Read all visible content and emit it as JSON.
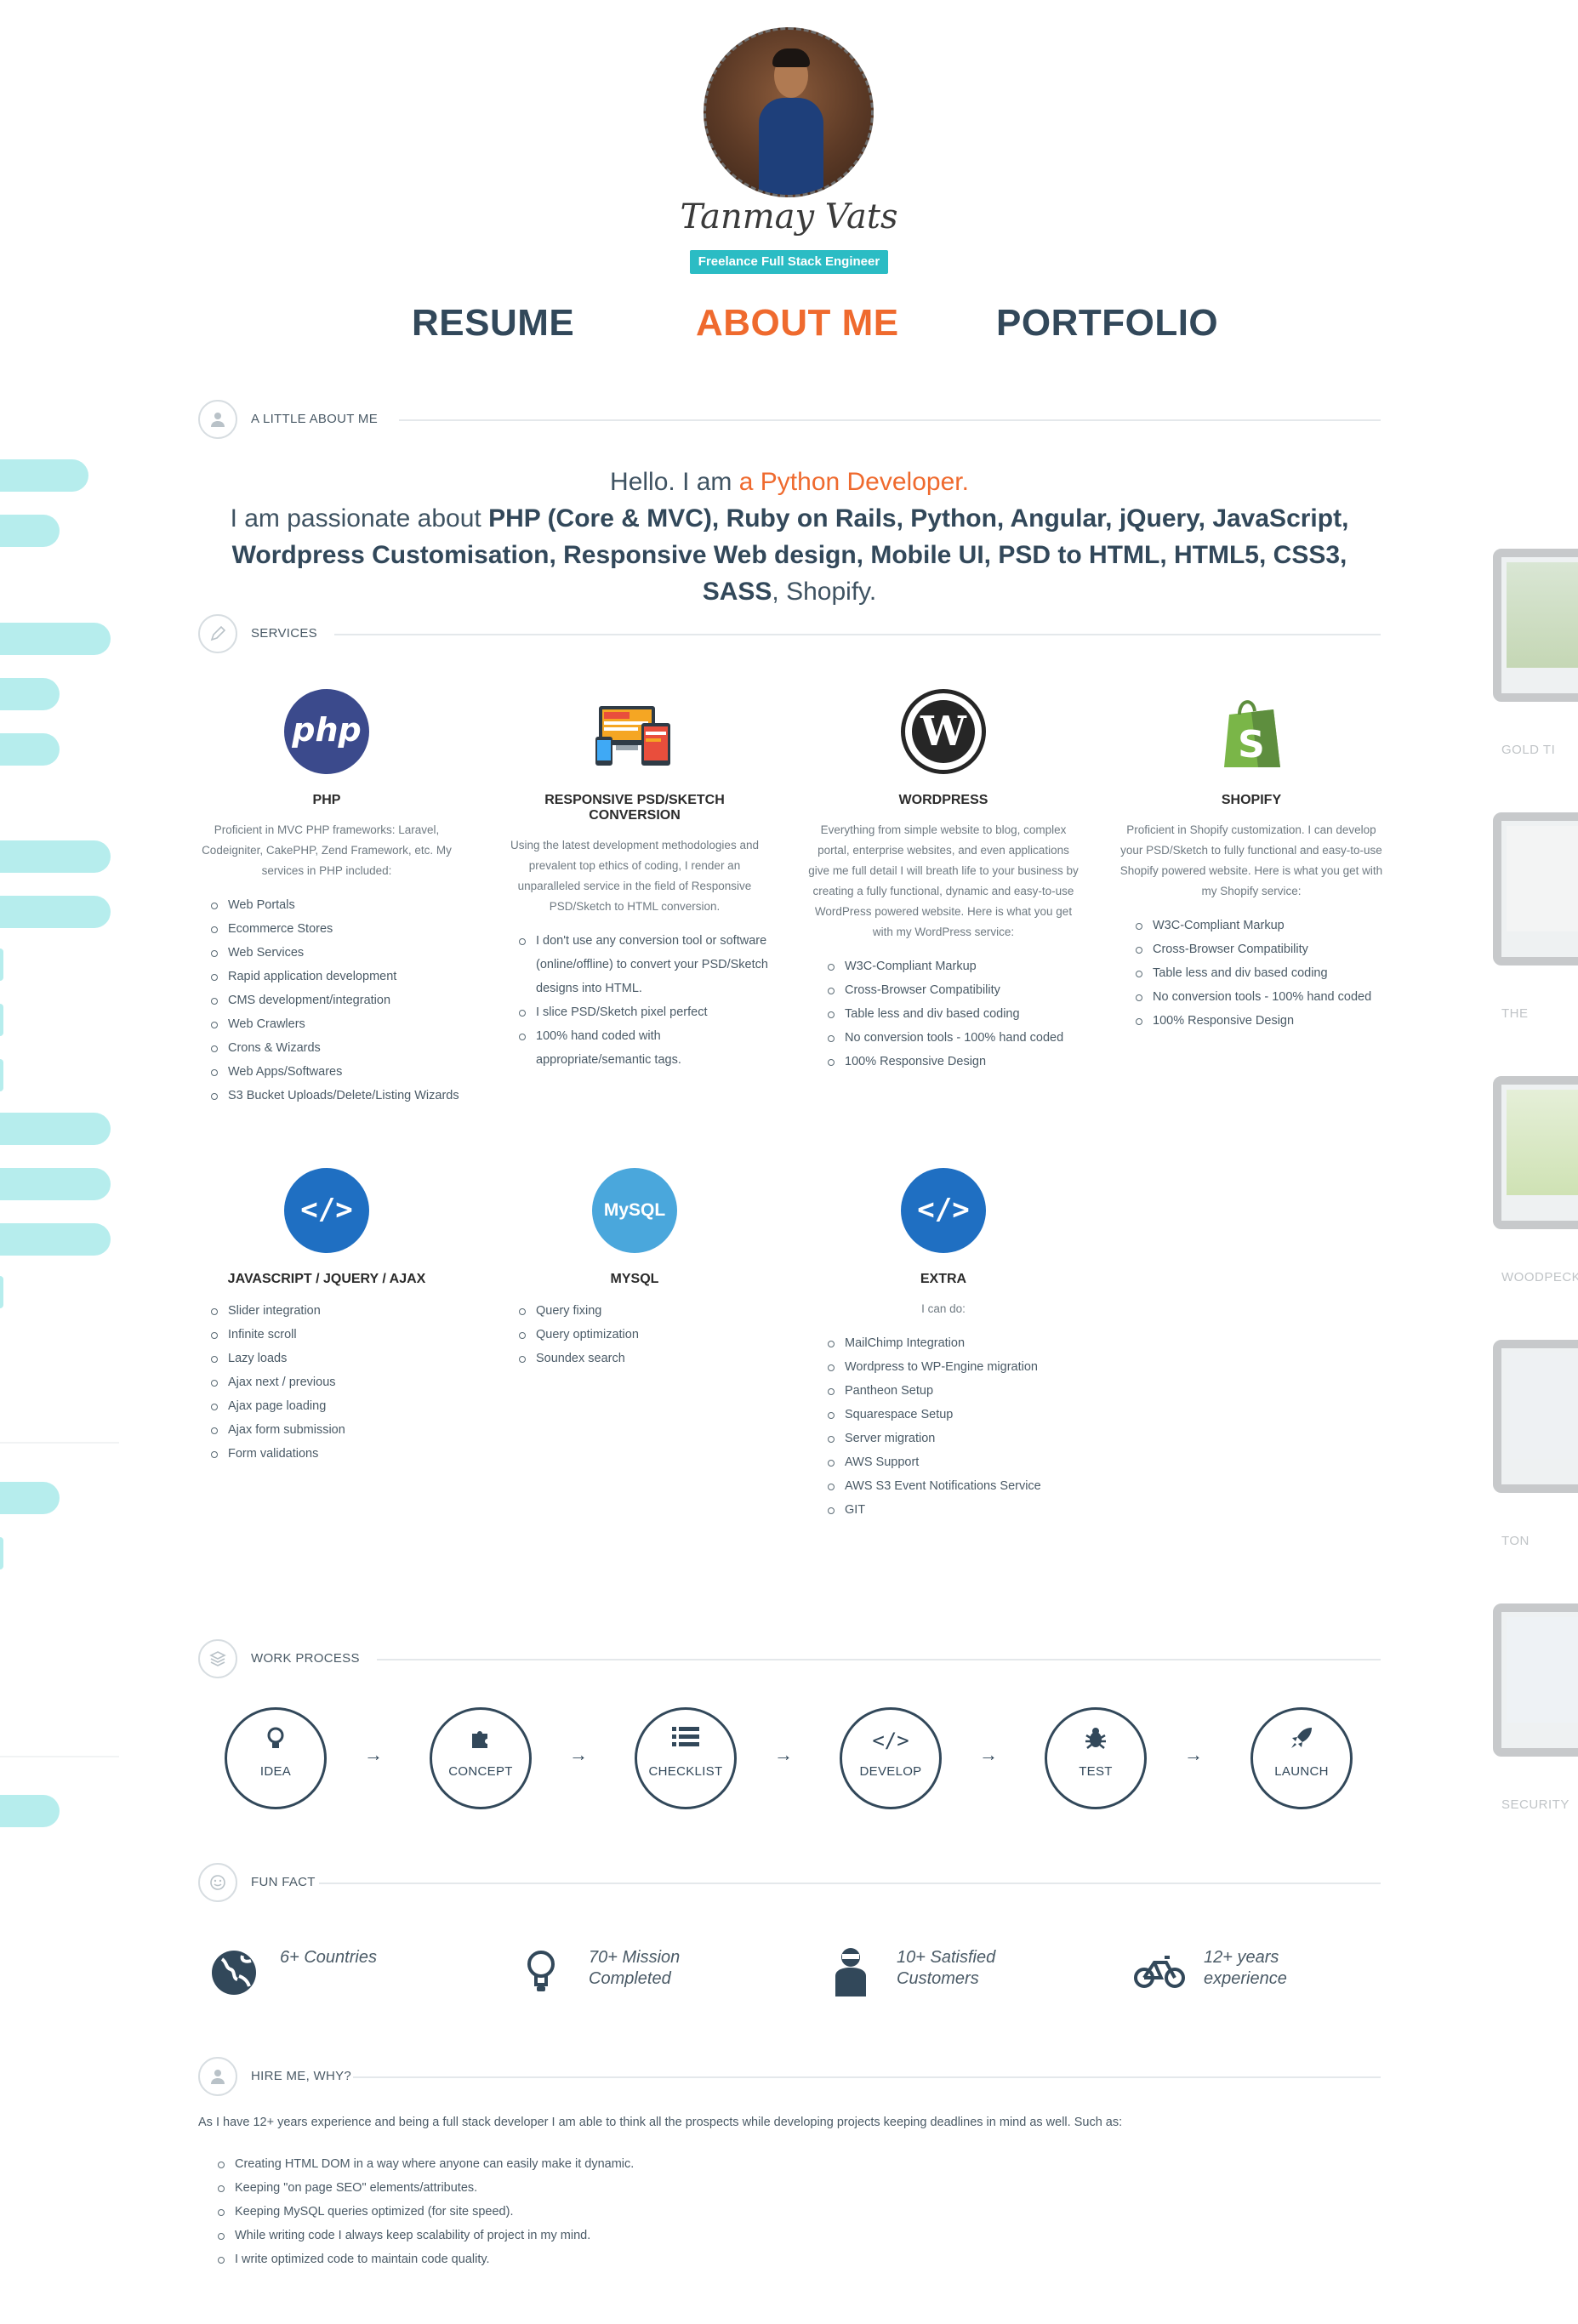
{
  "profile": {
    "name": "Tanmay Vats",
    "tagline": "Freelance Full Stack Engineer"
  },
  "nav": {
    "resume": "RESUME",
    "about": "ABOUT ME",
    "portfolio": "PORTFOLIO",
    "active": "ABOUT ME",
    "active_color": "#ef6a2e"
  },
  "sections": {
    "about": "A LITTLE ABOUT ME",
    "services": "SERVICES",
    "work_process": "WORK PROCESS",
    "fun_fact": "FUN FACT",
    "hire": "HIRE ME, WHY?"
  },
  "intro": {
    "line1_prefix": "Hello. I am ",
    "line1_highlight": "a Python Developer.",
    "line2_prefix": "I am passionate about ",
    "line2_bold": "PHP (Core & MVC), Ruby on Rails, Python, Angular, jQuery, JavaScript, Wordpress Customisation, Responsive Web design, Mobile UI, PSD to HTML, HTML5, CSS3, SASS",
    "line2_suffix": ", Shopify."
  },
  "services": [
    {
      "title": "PHP",
      "logo": "php-logo",
      "desc": "Proficient in MVC PHP frameworks: Laravel, Codeigniter, CakePHP, Zend Framework, etc. My services in PHP included:",
      "items": [
        "Web Portals",
        "Ecommerce Stores",
        "Web Services",
        "Rapid application development",
        "CMS development/integration",
        "Web Crawlers",
        "Crons & Wizards",
        "Web Apps/Softwares",
        "S3 Bucket Uploads/Delete/Listing Wizards"
      ]
    },
    {
      "title": "RESPONSIVE PSD/SKETCH CONVERSION",
      "logo": "responsive-devices-icon",
      "desc": "Using the latest development methodologies and prevalent top ethics of coding, I render an unparalleled service in the field of Responsive PSD/Sketch to HTML conversion.",
      "items": [
        "I don't use any conversion tool or software (online/offline) to convert your PSD/Sketch designs into HTML.",
        "I slice PSD/Sketch pixel perfect",
        "100% hand coded with appropriate/semantic tags."
      ]
    },
    {
      "title": "WORDPRESS",
      "logo": "wordpress-logo",
      "desc": "Everything from simple website to blog, complex portal, enterprise websites, and even applications give me full detail I will breath life to your business by creating a fully functional, dynamic and easy-to-use WordPress powered website. Here is what you get with my WordPress service:",
      "items": [
        "W3C-Compliant Markup",
        "Cross-Browser Compatibility",
        "Table less and div based coding",
        "No conversion tools - 100% hand coded",
        "100% Responsive Design"
      ]
    },
    {
      "title": "SHOPIFY",
      "logo": "shopify-logo",
      "desc": "Proficient in Shopify customization. I can develop your PSD/Sketch to fully functional and easy-to-use Shopify powered website. Here is what you get with my Shopify service:",
      "items": [
        "W3C-Compliant Markup",
        "Cross-Browser Compatibility",
        "Table less and div based coding",
        "No conversion tools - 100% hand coded",
        "100% Responsive Design"
      ]
    },
    {
      "title": "JAVASCRIPT / JQUERY / AJAX",
      "logo": "code-icon",
      "desc": "",
      "items": [
        "Slider integration",
        "Infinite scroll",
        "Lazy loads",
        "Ajax next / previous",
        "Ajax page loading",
        "Ajax form submission",
        "Form validations"
      ]
    },
    {
      "title": "MYSQL",
      "logo": "mysql-logo",
      "desc": "",
      "items": [
        "Query fixing",
        "Query optimization",
        "Soundex search"
      ]
    },
    {
      "title": "EXTRA",
      "logo": "code-icon",
      "desc": "I can do:",
      "items": [
        "MailChimp Integration",
        "Wordpress to WP-Engine migration",
        "Pantheon Setup",
        "Squarespace Setup",
        "Server migration",
        "AWS Support",
        "AWS S3 Event Notifications Service",
        "GIT"
      ]
    }
  ],
  "logos": {
    "php": "php",
    "wordpress": "W",
    "code": "</>",
    "mysql": "MySQL",
    "shopify": "S"
  },
  "process": {
    "arrow": "→",
    "steps": [
      {
        "label": "IDEA",
        "icon": "lightbulb-icon",
        "glyph": "💡"
      },
      {
        "label": "CONCEPT",
        "icon": "puzzle-icon",
        "glyph": "✣"
      },
      {
        "label": "CHECKLIST",
        "icon": "list-icon",
        "glyph": "☰"
      },
      {
        "label": "DEVELOP",
        "icon": "code-icon",
        "glyph": "</>"
      },
      {
        "label": "TEST",
        "icon": "bug-icon",
        "glyph": "✱"
      },
      {
        "label": "LAUNCH",
        "icon": "rocket-icon",
        "glyph": "➶"
      }
    ]
  },
  "facts": [
    {
      "line1": "6+ Countries",
      "line2": "",
      "icon": "globe-icon"
    },
    {
      "line1": "70+ Mission",
      "line2": "Completed",
      "icon": "lightbulb-icon"
    },
    {
      "line1": "10+ Satisfied",
      "line2": "Customers",
      "icon": "person-icon"
    },
    {
      "line1": "12+ years",
      "line2": "experience",
      "icon": "bicycle-icon"
    }
  ],
  "hire": {
    "intro": "As I have 12+ years experience and being a full stack developer I am able to think all the prospects while developing projects keeping deadlines in mind as well. Such as:",
    "items": [
      "Creating HTML DOM in a way where anyone can easily make it dynamic.",
      "Keeping \"on page SEO\" elements/attributes.",
      "Keeping MySQL queries optimized (for site speed).",
      "While writing code I always keep scalability of project in my mind.",
      "I write optimized code to maintain code quality."
    ]
  },
  "portfolio_side": {
    "captions": [
      "GOLD TI",
      "THE",
      "WOODPECK",
      "TON",
      "SECURITY"
    ]
  }
}
